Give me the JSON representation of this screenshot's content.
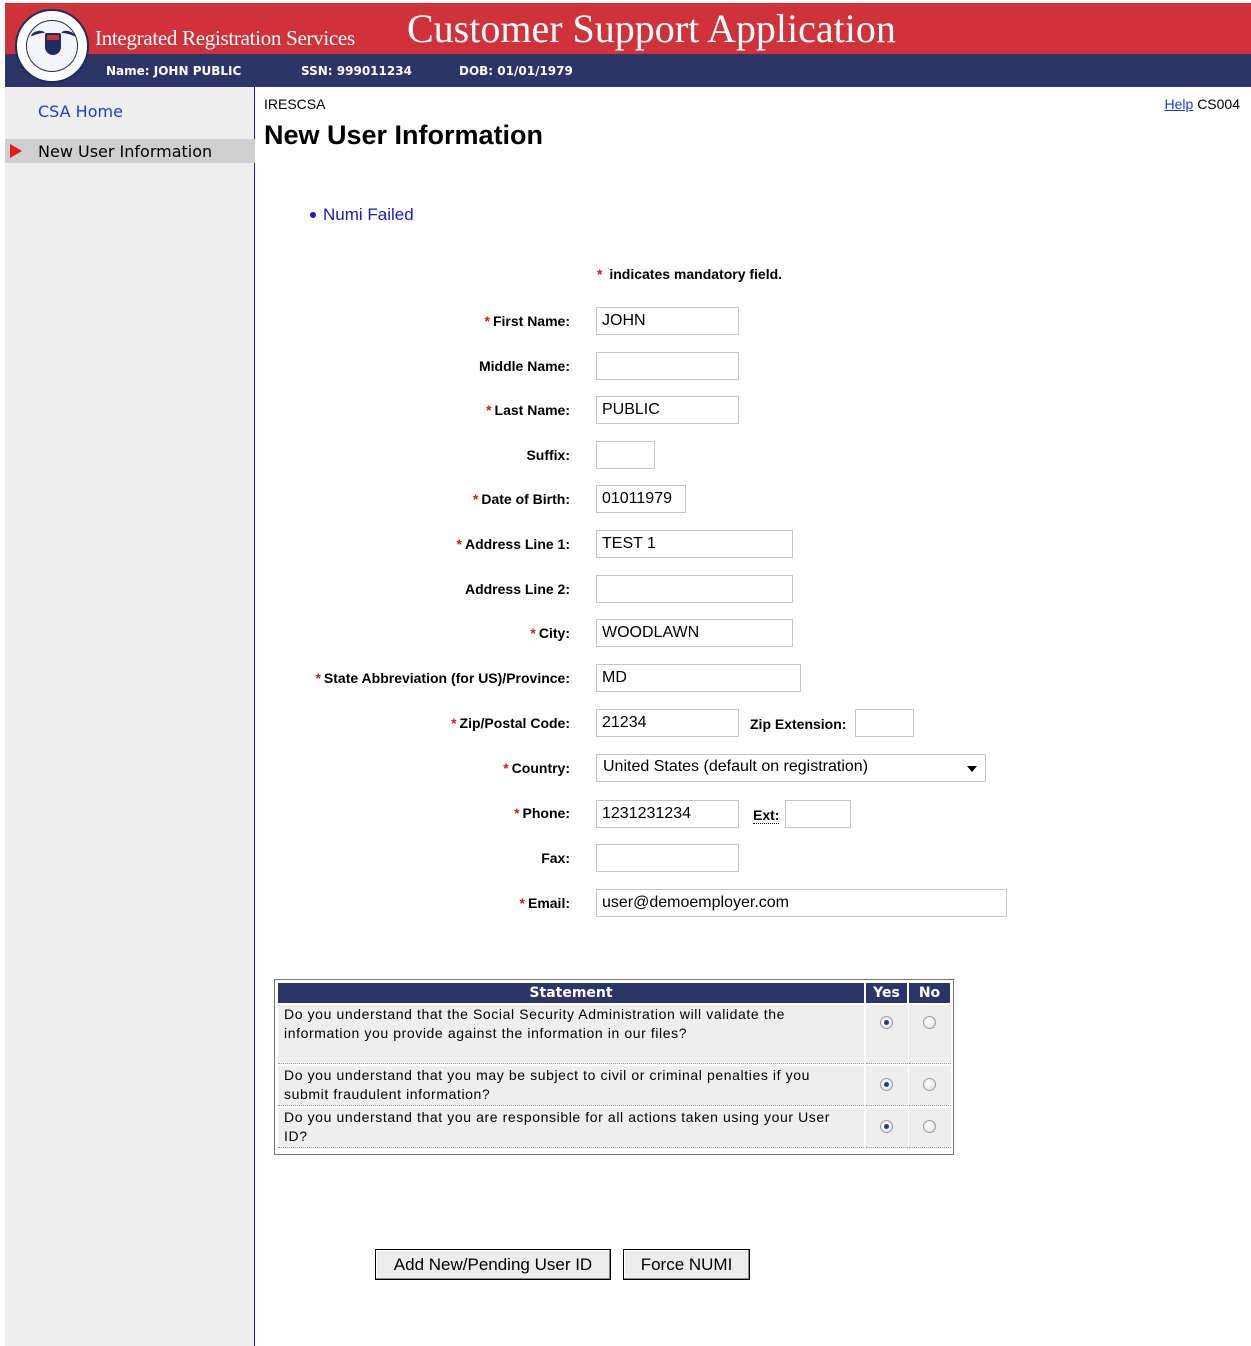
{
  "header": {
    "subtitle": "Integrated Registration Services",
    "title": "Customer Support Application",
    "name_info": "Name: JOHN PUBLIC",
    "ssn_info": "SSN: 999011234",
    "dob_info": "DOB: 01/01/1979"
  },
  "sidebar": {
    "home_link": "CSA Home",
    "active_item": "New User Information"
  },
  "page": {
    "screen_id": "IRESCSA",
    "help_link": "Help",
    "screen_code": "CS004",
    "title": "New User Information",
    "error_message": "Numi Failed",
    "mandatory_note": "indicates mandatory field.",
    "mandatory_star": "*"
  },
  "form": {
    "first_name": {
      "label": "First Name:",
      "value": "JOHN"
    },
    "middle_name": {
      "label": "Middle Name:",
      "value": ""
    },
    "last_name": {
      "label": "Last Name:",
      "value": "PUBLIC"
    },
    "suffix": {
      "label": "Suffix:",
      "value": ""
    },
    "dob": {
      "label": "Date of Birth:",
      "value": "01011979"
    },
    "address1": {
      "label": "Address Line 1:",
      "value": "TEST 1"
    },
    "address2": {
      "label": "Address Line 2:",
      "value": ""
    },
    "city": {
      "label": "City:",
      "value": "WOODLAWN"
    },
    "state": {
      "label": "State Abbreviation (for US)/Province:",
      "value": "MD"
    },
    "zip": {
      "label": "Zip/Postal Code:",
      "value": "21234"
    },
    "zip_ext": {
      "label": "Zip Extension:",
      "value": ""
    },
    "country": {
      "label": "Country:",
      "value": "United States (default on registration)"
    },
    "phone": {
      "label": "Phone:",
      "value": "1231231234"
    },
    "phone_ext": {
      "label": "Ext:",
      "value": ""
    },
    "fax": {
      "label": "Fax:",
      "value": ""
    },
    "email": {
      "label": "Email:",
      "value": "user@demoemployer.com"
    }
  },
  "statements": {
    "header_statement": "Statement",
    "header_yes": "Yes",
    "header_no": "No",
    "rows": [
      {
        "text": "Do you understand that the Social Security Administration will validate the information you provide against the information in our files?",
        "answer": "yes"
      },
      {
        "text": "Do you understand that you may be subject to civil or criminal penalties if you submit fraudulent information?",
        "answer": "yes"
      },
      {
        "text": "Do you understand that you are responsible for all actions taken using your User ID?",
        "answer": "yes"
      }
    ]
  },
  "buttons": {
    "add": "Add New/Pending User ID",
    "force": "Force NUMI"
  },
  "colors": {
    "header_red": "#d0323a",
    "header_navy": "#2b3568",
    "link_blue": "#1a3fd0",
    "required_red": "#d41a1a"
  }
}
